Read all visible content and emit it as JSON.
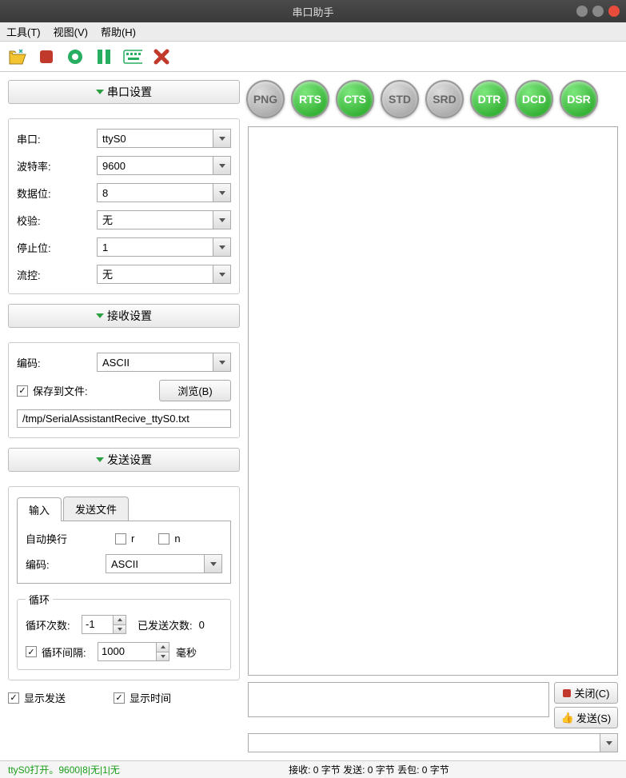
{
  "window": {
    "title": "串口助手"
  },
  "menu": {
    "tools": "工具(T)",
    "view": "视图(V)",
    "help": "帮助(H)"
  },
  "sections": {
    "serial": {
      "title": "串口设置",
      "port_label": "串口:",
      "port_value": "ttyS0",
      "baud_label": "波特率:",
      "baud_value": "9600",
      "databits_label": "数据位:",
      "databits_value": "8",
      "parity_label": "校验:",
      "parity_value": "无",
      "stopbits_label": "停止位:",
      "stopbits_value": "1",
      "flow_label": "流控:",
      "flow_value": "无"
    },
    "receive": {
      "title": "接收设置",
      "encoding_label": "编码:",
      "encoding_value": "ASCII",
      "save_label": "保存到文件:",
      "browse_label": "浏览(B)",
      "filepath": "/tmp/SerialAssistantRecive_ttyS0.txt"
    },
    "send": {
      "title": "发送设置",
      "tab_input": "输入",
      "tab_file": "发送文件",
      "autowrap_label": "自动换行",
      "r_label": "r",
      "n_label": "n",
      "encoding_label": "编码:",
      "encoding_value": "ASCII",
      "loop_legend": "循环",
      "loop_count_label": "循环次数:",
      "loop_count_value": "-1",
      "sent_count_label": "已发送次数:",
      "sent_count_value": "0",
      "loop_interval_label": "循环间隔:",
      "loop_interval_value": "1000",
      "loop_interval_unit": "毫秒"
    }
  },
  "bottom_checks": {
    "show_send": "显示发送",
    "show_time": "显示时间"
  },
  "indicators": {
    "png": "PNG",
    "rts": "RTS",
    "cts": "CTS",
    "std": "STD",
    "srd": "SRD",
    "dtr": "DTR",
    "dcd": "DCD",
    "dsr": "DSR"
  },
  "buttons": {
    "close": "关闭(C)",
    "send": "发送(S)"
  },
  "status": {
    "left": "ttyS0打开。9600|8|无|1|无",
    "center": "接收: 0 字节  发送: 0 字节  丢包: 0 字节"
  }
}
